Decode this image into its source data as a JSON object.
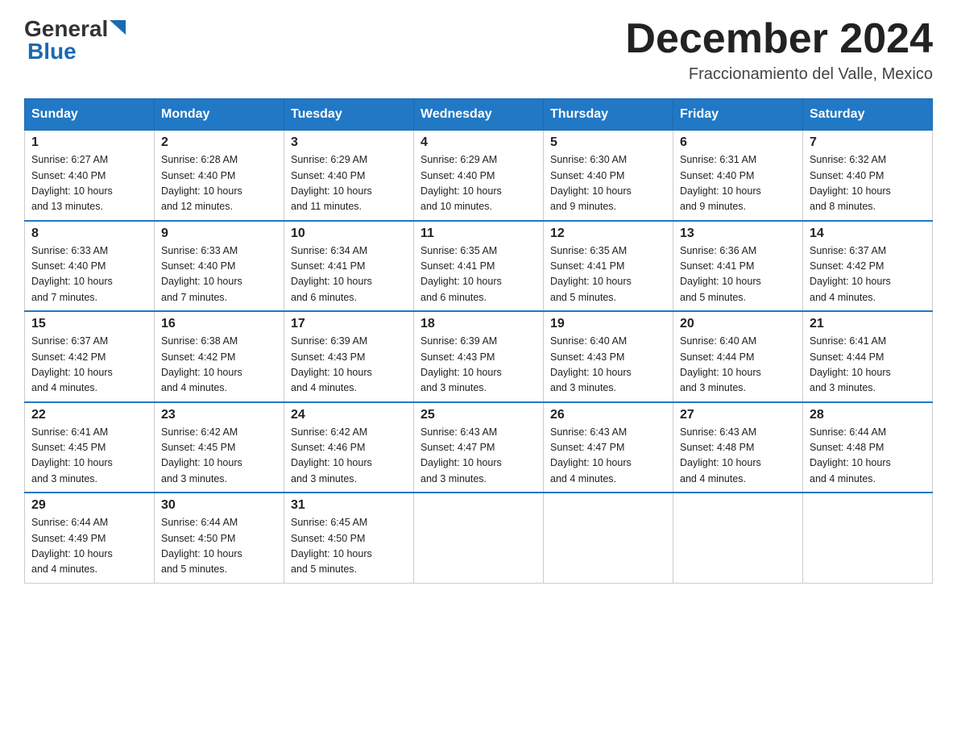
{
  "header": {
    "logo_general": "General",
    "logo_blue": "Blue",
    "month_title": "December 2024",
    "subtitle": "Fraccionamiento del Valle, Mexico"
  },
  "days_of_week": [
    "Sunday",
    "Monday",
    "Tuesday",
    "Wednesday",
    "Thursday",
    "Friday",
    "Saturday"
  ],
  "weeks": [
    [
      {
        "day": "1",
        "sunrise": "6:27 AM",
        "sunset": "4:40 PM",
        "daylight": "10 hours and 13 minutes."
      },
      {
        "day": "2",
        "sunrise": "6:28 AM",
        "sunset": "4:40 PM",
        "daylight": "10 hours and 12 minutes."
      },
      {
        "day": "3",
        "sunrise": "6:29 AM",
        "sunset": "4:40 PM",
        "daylight": "10 hours and 11 minutes."
      },
      {
        "day": "4",
        "sunrise": "6:29 AM",
        "sunset": "4:40 PM",
        "daylight": "10 hours and 10 minutes."
      },
      {
        "day": "5",
        "sunrise": "6:30 AM",
        "sunset": "4:40 PM",
        "daylight": "10 hours and 9 minutes."
      },
      {
        "day": "6",
        "sunrise": "6:31 AM",
        "sunset": "4:40 PM",
        "daylight": "10 hours and 9 minutes."
      },
      {
        "day": "7",
        "sunrise": "6:32 AM",
        "sunset": "4:40 PM",
        "daylight": "10 hours and 8 minutes."
      }
    ],
    [
      {
        "day": "8",
        "sunrise": "6:33 AM",
        "sunset": "4:40 PM",
        "daylight": "10 hours and 7 minutes."
      },
      {
        "day": "9",
        "sunrise": "6:33 AM",
        "sunset": "4:40 PM",
        "daylight": "10 hours and 7 minutes."
      },
      {
        "day": "10",
        "sunrise": "6:34 AM",
        "sunset": "4:41 PM",
        "daylight": "10 hours and 6 minutes."
      },
      {
        "day": "11",
        "sunrise": "6:35 AM",
        "sunset": "4:41 PM",
        "daylight": "10 hours and 6 minutes."
      },
      {
        "day": "12",
        "sunrise": "6:35 AM",
        "sunset": "4:41 PM",
        "daylight": "10 hours and 5 minutes."
      },
      {
        "day": "13",
        "sunrise": "6:36 AM",
        "sunset": "4:41 PM",
        "daylight": "10 hours and 5 minutes."
      },
      {
        "day": "14",
        "sunrise": "6:37 AM",
        "sunset": "4:42 PM",
        "daylight": "10 hours and 4 minutes."
      }
    ],
    [
      {
        "day": "15",
        "sunrise": "6:37 AM",
        "sunset": "4:42 PM",
        "daylight": "10 hours and 4 minutes."
      },
      {
        "day": "16",
        "sunrise": "6:38 AM",
        "sunset": "4:42 PM",
        "daylight": "10 hours and 4 minutes."
      },
      {
        "day": "17",
        "sunrise": "6:39 AM",
        "sunset": "4:43 PM",
        "daylight": "10 hours and 4 minutes."
      },
      {
        "day": "18",
        "sunrise": "6:39 AM",
        "sunset": "4:43 PM",
        "daylight": "10 hours and 3 minutes."
      },
      {
        "day": "19",
        "sunrise": "6:40 AM",
        "sunset": "4:43 PM",
        "daylight": "10 hours and 3 minutes."
      },
      {
        "day": "20",
        "sunrise": "6:40 AM",
        "sunset": "4:44 PM",
        "daylight": "10 hours and 3 minutes."
      },
      {
        "day": "21",
        "sunrise": "6:41 AM",
        "sunset": "4:44 PM",
        "daylight": "10 hours and 3 minutes."
      }
    ],
    [
      {
        "day": "22",
        "sunrise": "6:41 AM",
        "sunset": "4:45 PM",
        "daylight": "10 hours and 3 minutes."
      },
      {
        "day": "23",
        "sunrise": "6:42 AM",
        "sunset": "4:45 PM",
        "daylight": "10 hours and 3 minutes."
      },
      {
        "day": "24",
        "sunrise": "6:42 AM",
        "sunset": "4:46 PM",
        "daylight": "10 hours and 3 minutes."
      },
      {
        "day": "25",
        "sunrise": "6:43 AM",
        "sunset": "4:47 PM",
        "daylight": "10 hours and 3 minutes."
      },
      {
        "day": "26",
        "sunrise": "6:43 AM",
        "sunset": "4:47 PM",
        "daylight": "10 hours and 4 minutes."
      },
      {
        "day": "27",
        "sunrise": "6:43 AM",
        "sunset": "4:48 PM",
        "daylight": "10 hours and 4 minutes."
      },
      {
        "day": "28",
        "sunrise": "6:44 AM",
        "sunset": "4:48 PM",
        "daylight": "10 hours and 4 minutes."
      }
    ],
    [
      {
        "day": "29",
        "sunrise": "6:44 AM",
        "sunset": "4:49 PM",
        "daylight": "10 hours and 4 minutes."
      },
      {
        "day": "30",
        "sunrise": "6:44 AM",
        "sunset": "4:50 PM",
        "daylight": "10 hours and 5 minutes."
      },
      {
        "day": "31",
        "sunrise": "6:45 AM",
        "sunset": "4:50 PM",
        "daylight": "10 hours and 5 minutes."
      },
      null,
      null,
      null,
      null
    ]
  ],
  "labels": {
    "sunrise": "Sunrise:",
    "sunset": "Sunset:",
    "daylight": "Daylight:"
  }
}
